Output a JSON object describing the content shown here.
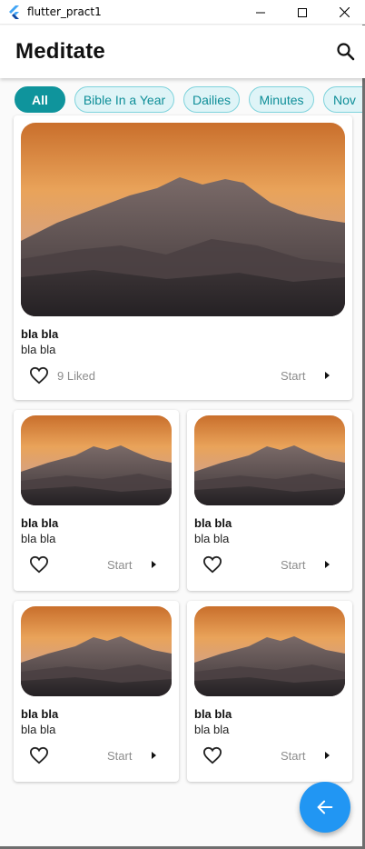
{
  "window": {
    "title": "flutter_pract1"
  },
  "appbar": {
    "title": "Meditate",
    "search_icon": "search-icon"
  },
  "chips": [
    {
      "label": "All",
      "active": true
    },
    {
      "label": "Bible In a Year",
      "active": false
    },
    {
      "label": "Dailies",
      "active": false
    },
    {
      "label": "Minutes",
      "active": false
    },
    {
      "label": "Nov",
      "active": false
    }
  ],
  "featured": {
    "title": "bla bla",
    "subtitle": "bla bla",
    "likes": "9 Liked",
    "start": "Start"
  },
  "grid": [
    {
      "title": "bla bla",
      "subtitle": "bla bla",
      "start": "Start"
    },
    {
      "title": "bla bla",
      "subtitle": "bla bla",
      "start": "Start"
    },
    {
      "title": "bla bla",
      "subtitle": "bla bla",
      "start": "Start"
    },
    {
      "title": "bla bla",
      "subtitle": "bla bla",
      "start": "Start"
    }
  ],
  "colors": {
    "chip_active": "#0f949c",
    "chip_inactive_bg": "#dff4f7",
    "fab": "#2196f3"
  },
  "fab": {
    "icon": "arrow-back-icon"
  }
}
